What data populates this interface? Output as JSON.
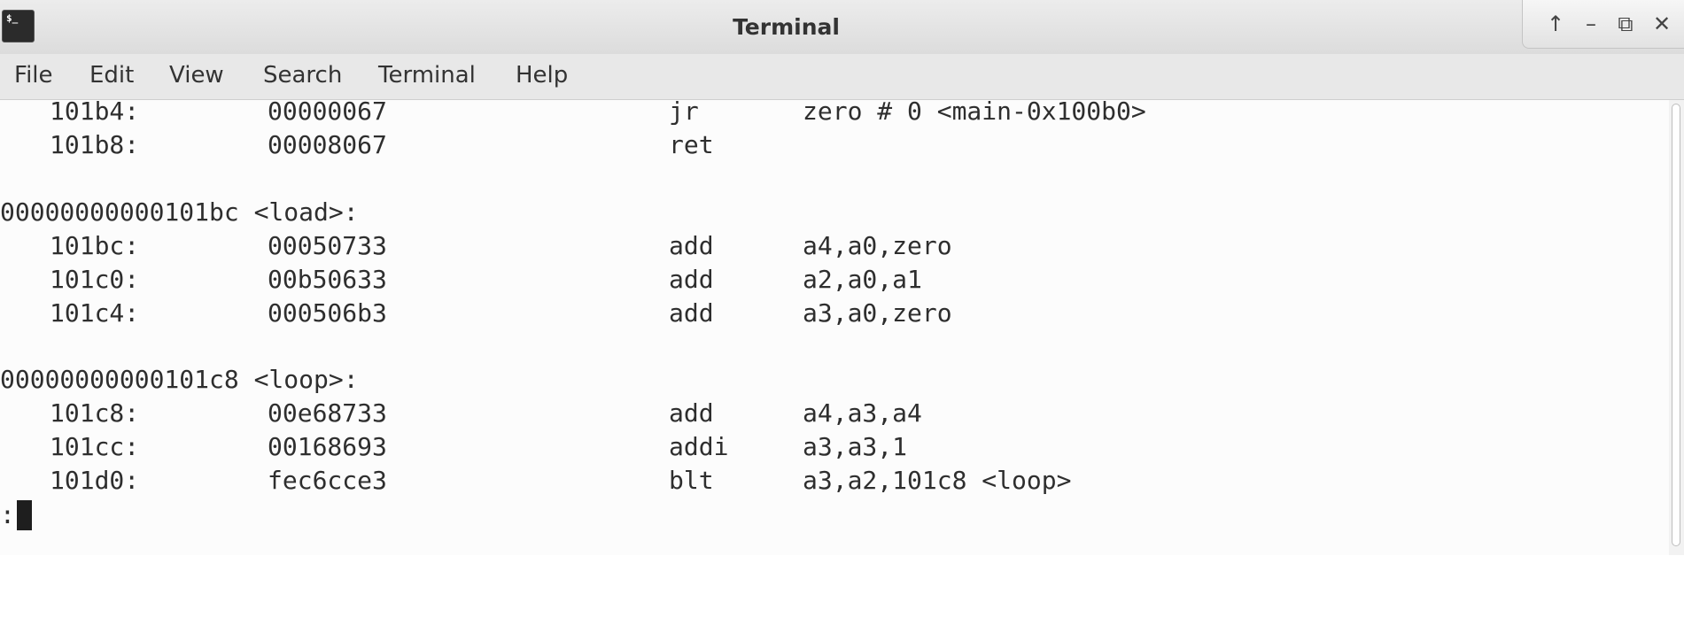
{
  "window": {
    "title": "Terminal",
    "app_icon_label": "$_",
    "controls": {
      "up": "↑",
      "minimize": "–",
      "restore": "⧉",
      "close": "✕"
    }
  },
  "menu": [
    "File",
    "Edit",
    "View",
    "Search",
    "Terminal",
    "Help"
  ],
  "terminal": {
    "rows": [
      {
        "addr": "101b4:",
        "hex": "00000067",
        "op": "jr",
        "args": "zero # 0 <main-0x100b0>"
      },
      {
        "addr": "101b8:",
        "hex": "00008067",
        "op": "ret",
        "args": ""
      },
      {
        "label": "00000000000101bc <load>:"
      },
      {
        "addr": "101bc:",
        "hex": "00050733",
        "op": "add",
        "args": "a4,a0,zero"
      },
      {
        "addr": "101c0:",
        "hex": "00b50633",
        "op": "add",
        "args": "a2,a0,a1"
      },
      {
        "addr": "101c4:",
        "hex": "000506b3",
        "op": "add",
        "args": "a3,a0,zero"
      },
      {
        "label": "00000000000101c8 <loop>:"
      },
      {
        "addr": "101c8:",
        "hex": "00e68733",
        "op": "add",
        "args": "a4,a3,a4"
      },
      {
        "addr": "101cc:",
        "hex": "00168693",
        "op": "addi",
        "args": "a3,a3,1"
      },
      {
        "addr": "101d0:",
        "hex": "fec6cce3",
        "op": "blt",
        "args": "a3,a2,101c8 <loop>"
      }
    ],
    "prompt": ":"
  }
}
